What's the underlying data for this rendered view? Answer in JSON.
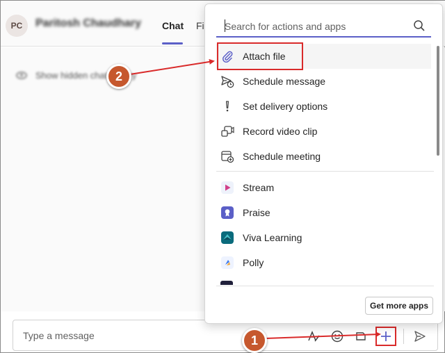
{
  "chat": {
    "avatar_initials": "PC",
    "contact_name": "Paritosh Chaudhary",
    "tabs": [
      {
        "label": "Chat"
      },
      {
        "label": "Fil"
      }
    ],
    "hidden_history_text": "Show hidden chat history",
    "composer_placeholder": "Type a message"
  },
  "popup": {
    "search_placeholder": "Search for actions and apps",
    "actions": [
      {
        "label": "Attach file",
        "icon": "paperclip-icon"
      },
      {
        "label": "Schedule message",
        "icon": "send-clock-icon"
      },
      {
        "label": "Set delivery options",
        "icon": "exclamation-icon"
      },
      {
        "label": "Record video clip",
        "icon": "video-clip-icon"
      },
      {
        "label": "Schedule meeting",
        "icon": "calendar-add-icon"
      }
    ],
    "apps": [
      {
        "label": "Stream",
        "icon": "stream-icon",
        "color": "#e8f0fb"
      },
      {
        "label": "Praise",
        "icon": "praise-icon",
        "color": "#5b5fc7"
      },
      {
        "label": "Viva Learning",
        "icon": "viva-learning-icon",
        "color": "#0a6b7c"
      },
      {
        "label": "Polly",
        "icon": "polly-icon",
        "color": "#eef3ff"
      }
    ],
    "get_more_label": "Get more apps"
  },
  "annotations": {
    "step1": "1",
    "step2": "2",
    "color": "#d92a2a",
    "badge_color": "#c6582e"
  }
}
